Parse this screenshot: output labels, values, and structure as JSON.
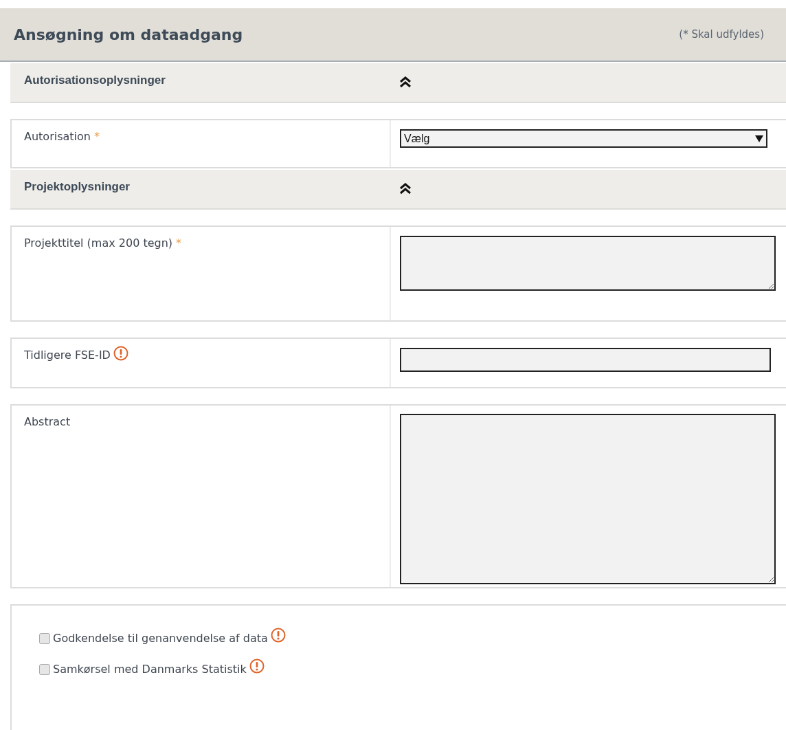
{
  "header": {
    "title": "Ansøgning om dataadgang",
    "required_note": "(* Skal udfyldes)"
  },
  "sections": [
    {
      "title": "Autorisationsoplysninger",
      "expanded": true,
      "rows": [
        {
          "kind": "select",
          "label": "Autorisation",
          "required_mark": "*",
          "info": false,
          "value": "Vælg"
        }
      ]
    },
    {
      "title": "Projektoplysninger",
      "expanded": true,
      "rows": [
        {
          "kind": "textarea",
          "label": "Projekttitel (max 200 tegn)",
          "required_mark": "*",
          "info": false
        },
        {
          "kind": "input",
          "label": "Tidligere FSE-ID",
          "info": true
        },
        {
          "kind": "bigtextarea",
          "label": "Abstract",
          "info": false
        }
      ]
    }
  ],
  "checkboxes": [
    {
      "label": "Godkendelse til genanvendelse af data",
      "checked": false,
      "info": true
    },
    {
      "label": "Samkørsel med Danmarks Statistik",
      "checked": false,
      "info": true
    }
  ]
}
